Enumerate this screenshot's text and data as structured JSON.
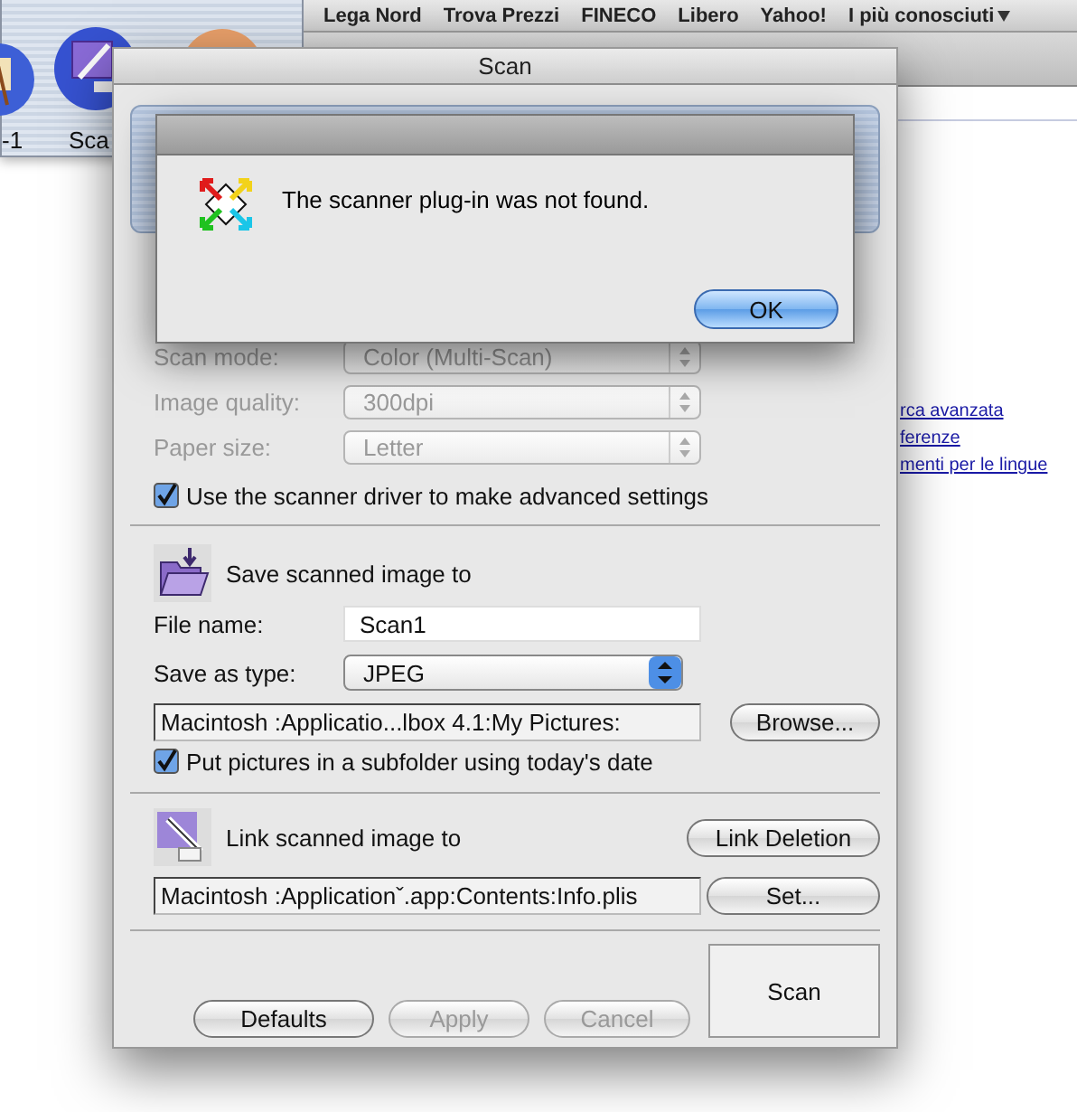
{
  "palette": {
    "items": [
      {
        "label": "-1"
      },
      {
        "label": "Sca"
      }
    ]
  },
  "browser": {
    "bookmarks": [
      "Lega Nord",
      "Trova Prezzi",
      "FINECO",
      "Libero",
      "Yahoo!",
      "I più conosciuti"
    ],
    "links": [
      "rca avanzata",
      "ferenze",
      "menti per le lingue"
    ]
  },
  "scan_dialog": {
    "title": "Scan",
    "settings": [
      {
        "label": "Scan mode:",
        "value": "Color (Multi-Scan)",
        "disabled": true
      },
      {
        "label": "Image quality:",
        "value": "300dpi",
        "disabled": true
      },
      {
        "label": "Paper size:",
        "value": "Letter",
        "disabled": true
      }
    ],
    "advanced_driver": {
      "label": "Use the scanner driver to make advanced settings",
      "checked": true
    },
    "save": {
      "heading": "Save scanned image to",
      "file_name": {
        "label": "File name:",
        "value": "Scan1"
      },
      "save_as_type": {
        "label": "Save as type:",
        "value": "JPEG"
      },
      "path": "Macintosh :Applicatio...lbox 4.1:My Pictures:",
      "browse": "Browse...",
      "subfolder": {
        "label": "Put pictures in a subfolder using today's date",
        "checked": true
      }
    },
    "link": {
      "heading": "Link scanned image to",
      "link_deletion": "Link Deletion",
      "path": "Macintosh :Applicationˇ.app:Contents:Info.plis",
      "set": "Set..."
    },
    "buttons": [
      {
        "label": "Defaults",
        "disabled": false
      },
      {
        "label": "Apply",
        "disabled": true
      },
      {
        "label": "Cancel",
        "disabled": true
      }
    ],
    "scan_button": "Scan"
  },
  "alert": {
    "message": "The scanner plug-in was not found.",
    "button": "OK"
  }
}
